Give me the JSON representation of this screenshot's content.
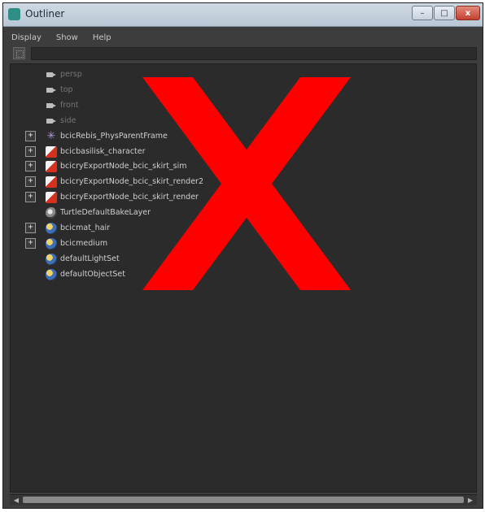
{
  "window": {
    "title": "Outliner",
    "minimize_glyph": "–",
    "maximize_glyph": "□",
    "close_glyph": "x"
  },
  "menu": {
    "items": [
      "Display",
      "Show",
      "Help"
    ]
  },
  "filter": {
    "value": "",
    "placeholder": ""
  },
  "outliner": {
    "rows": [
      {
        "label": "persp",
        "icon": "camera-icon",
        "expandable": false,
        "dim": true
      },
      {
        "label": "top",
        "icon": "camera-icon",
        "expandable": false,
        "dim": true
      },
      {
        "label": "front",
        "icon": "camera-icon",
        "expandable": false,
        "dim": true
      },
      {
        "label": "side",
        "icon": "camera-icon",
        "expandable": false,
        "dim": true
      },
      {
        "label": "bcicRebis_PhysParentFrame",
        "icon": "star-icon",
        "expandable": true,
        "dim": false
      },
      {
        "label": "bcicbasilisk_character",
        "icon": "shader-icon",
        "expandable": true,
        "dim": false
      },
      {
        "label": "bcicryExportNode_bcic_skirt_sim",
        "icon": "shader-icon",
        "expandable": true,
        "dim": false
      },
      {
        "label": "bcicryExportNode_bcic_skirt_render2",
        "icon": "shader-icon",
        "expandable": true,
        "dim": false
      },
      {
        "label": "bcicryExportNode_bcic_skirt_render",
        "icon": "shader-icon",
        "expandable": true,
        "dim": false
      },
      {
        "label": "TurtleDefaultBakeLayer",
        "icon": "layer-icon",
        "expandable": false,
        "dim": false
      },
      {
        "label": "bcicmat_hair",
        "icon": "set-icon",
        "expandable": true,
        "dim": false
      },
      {
        "label": "bcicmedium",
        "icon": "set-icon",
        "expandable": true,
        "dim": false
      },
      {
        "label": "defaultLightSet",
        "icon": "set-icon",
        "expandable": false,
        "dim": false
      },
      {
        "label": "defaultObjectSet",
        "icon": "set-icon",
        "expandable": false,
        "dim": false
      }
    ]
  },
  "overlay": {
    "icon": "red-x-cross-icon",
    "color": "#ff0000"
  },
  "colors": {
    "panel_bg": "#3d3d3d",
    "list_bg": "#2b2b2b",
    "text": "#cfcfcf",
    "dim_text": "#767676"
  }
}
